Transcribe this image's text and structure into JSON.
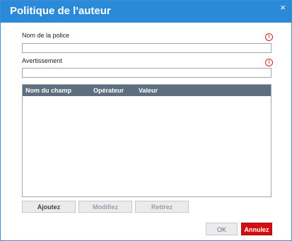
{
  "dialog": {
    "title": "Politique de l'auteur",
    "close_glyph": "×"
  },
  "fields": {
    "policy_name": {
      "label": "Nom de la police",
      "value": "",
      "placeholder": "",
      "required_icon": "!"
    },
    "warning": {
      "label": "Avertissement",
      "value": "",
      "placeholder": "",
      "required_icon": "!"
    }
  },
  "table": {
    "columns": [
      "Nom du champ",
      "Opérateur",
      "Valeur"
    ],
    "rows": []
  },
  "actions": {
    "add": "Ajoutez",
    "modify": "Modifiez",
    "remove": "Retirez"
  },
  "footer": {
    "ok": "OK",
    "cancel": "Annulez"
  },
  "colors": {
    "titlebar": "#2a8ad8",
    "table_header": "#5e6e7e",
    "cancel_button": "#d40d12",
    "required_icon": "#d11b1b"
  }
}
